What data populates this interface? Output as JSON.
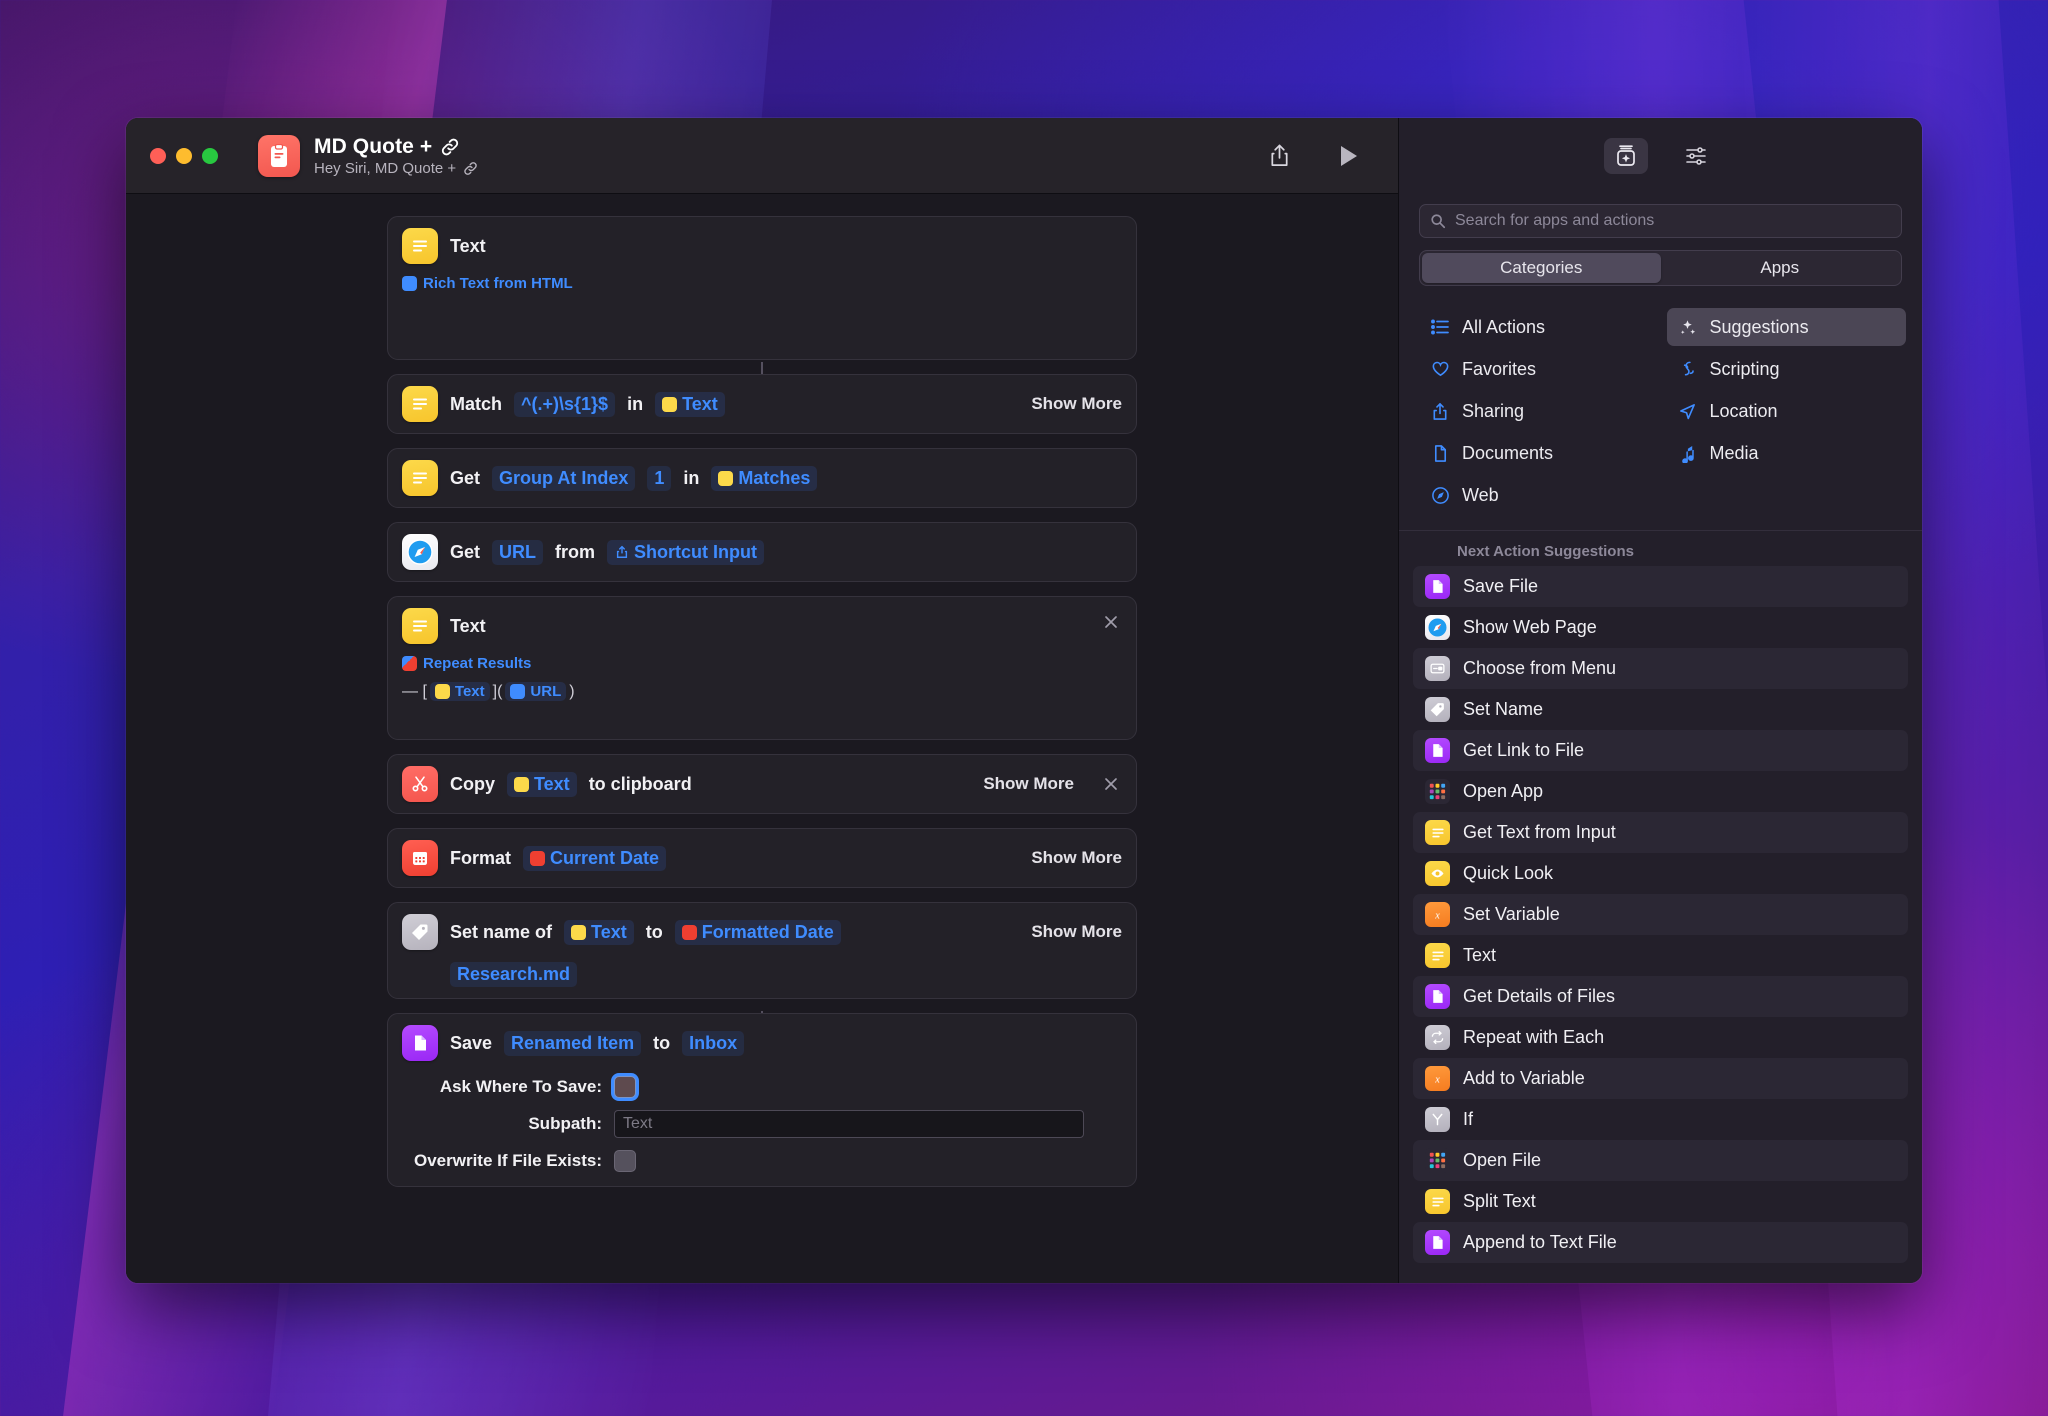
{
  "window": {
    "title": "MD Quote + ",
    "title_link_glyph": "link-icon",
    "subtitle": "Hey Siri, MD Quote + ",
    "app_icon": "shortcut-clipboard-icon",
    "share_icon": "share-icon",
    "run_icon": "play-icon"
  },
  "actions": [
    {
      "index": 0,
      "icon": "text-action-icon",
      "title": "Text",
      "token": "Rich Text from HTML",
      "token_icon": "variable-text-icon",
      "type": "text-block"
    },
    {
      "index": 1,
      "icon": "text-action-icon",
      "label": "Match",
      "regex": "^(.+)\\s{1}$",
      "in": "in",
      "variable": "Text",
      "show_more": "Show More",
      "type": "match"
    },
    {
      "index": 2,
      "icon": "text-action-icon",
      "label": "Get",
      "param": "Group At Index",
      "value": "1",
      "in": "in",
      "variable": "Matches",
      "type": "get-group"
    },
    {
      "index": 3,
      "icon": "safari-icon",
      "label": "Get",
      "param": "URL",
      "from": "from",
      "variable": "Shortcut Input",
      "type": "get-url"
    },
    {
      "index": 4,
      "icon": "text-action-icon",
      "title": "Text",
      "token": "Repeat Results",
      "md_prefix": "— [",
      "md_text": "Text",
      "md_mid": "](",
      "md_url": "URL",
      "md_suffix": ")",
      "close": "close-icon",
      "type": "text-md-block"
    },
    {
      "index": 5,
      "icon": "scissors-icon",
      "label": "Copy",
      "variable": "Text",
      "suffix": "to clipboard",
      "show_more": "Show More",
      "close": "close-icon",
      "type": "copy"
    },
    {
      "index": 6,
      "icon": "calendar-icon",
      "label": "Format",
      "variable": "Current Date",
      "show_more": "Show More",
      "type": "format-date"
    },
    {
      "index": 7,
      "icon": "tag-icon",
      "label": "Set name of",
      "variable": "Text",
      "to": "to",
      "variable2": "Formatted Date",
      "filename": "Research.md",
      "show_more": "Show More",
      "type": "set-name"
    },
    {
      "index": 8,
      "icon": "file-icon",
      "label": "Save",
      "variable": "Renamed Item",
      "to": "to",
      "destination": "Inbox",
      "type": "save",
      "params": [
        {
          "label": "Ask Where To Save:",
          "control": "toggle",
          "focused": true
        },
        {
          "label": "Subpath:",
          "control": "text-input",
          "placeholder": "Text",
          "value": ""
        },
        {
          "label": "Overwrite If File Exists:",
          "control": "toggle",
          "focused": false
        }
      ]
    }
  ],
  "sidebar": {
    "top_buttons": [
      {
        "name": "action-library-icon",
        "active": true
      },
      {
        "name": "shortcut-details-icon",
        "active": false
      }
    ],
    "search": {
      "placeholder": "Search for apps and actions",
      "icon": "search-icon"
    },
    "tabs": [
      {
        "label": "Categories",
        "active": true
      },
      {
        "label": "Apps",
        "active": false
      }
    ],
    "categories": [
      {
        "label": "All Actions",
        "icon": "list-icon",
        "selected": false
      },
      {
        "label": "Suggestions",
        "icon": "sparkles-icon",
        "selected": true
      },
      {
        "label": "Favorites",
        "icon": "heart-icon",
        "selected": false
      },
      {
        "label": "Scripting",
        "icon": "scripting-icon",
        "selected": false
      },
      {
        "label": "Sharing",
        "icon": "share-up-icon",
        "selected": false
      },
      {
        "label": "Location",
        "icon": "location-arrow-icon",
        "selected": false
      },
      {
        "label": "Documents",
        "icon": "document-icon",
        "selected": false
      },
      {
        "label": "Media",
        "icon": "music-note-icon",
        "selected": false
      },
      {
        "label": "Web",
        "icon": "compass-icon",
        "selected": false
      }
    ],
    "suggestions_header": "Next Action Suggestions",
    "suggestions": [
      {
        "label": "Save File",
        "icon": "file-purple-icon"
      },
      {
        "label": "Show Web Page",
        "icon": "safari-icon"
      },
      {
        "label": "Choose from Menu",
        "icon": "menu-gray-icon"
      },
      {
        "label": "Set Name",
        "icon": "tag-gray-icon"
      },
      {
        "label": "Get Link to File",
        "icon": "file-purple-icon"
      },
      {
        "label": "Open App",
        "icon": "apps-grid-icon"
      },
      {
        "label": "Get Text from Input",
        "icon": "text-yellow-icon"
      },
      {
        "label": "Quick Look",
        "icon": "eye-yellow-icon"
      },
      {
        "label": "Set Variable",
        "icon": "variable-orange-icon"
      },
      {
        "label": "Text",
        "icon": "text-yellow-icon"
      },
      {
        "label": "Get Details of Files",
        "icon": "file-purple-icon"
      },
      {
        "label": "Repeat with Each",
        "icon": "repeat-gray-icon"
      },
      {
        "label": "Add to Variable",
        "icon": "variable-orange-icon"
      },
      {
        "label": "If",
        "icon": "branch-gray-icon"
      },
      {
        "label": "Open File",
        "icon": "apps-grid-icon"
      },
      {
        "label": "Split Text",
        "icon": "text-yellow-icon"
      },
      {
        "label": "Append to Text File",
        "icon": "file-purple-icon"
      }
    ]
  },
  "colors": {
    "accent_blue": "#3f8cff",
    "yellow": "#fcd94a",
    "red": "#ef3f31",
    "purple": "#9a27f5",
    "window_bg": "#1b1920",
    "card_bg": "#232128",
    "sidebar_bg": "#231f2a"
  }
}
